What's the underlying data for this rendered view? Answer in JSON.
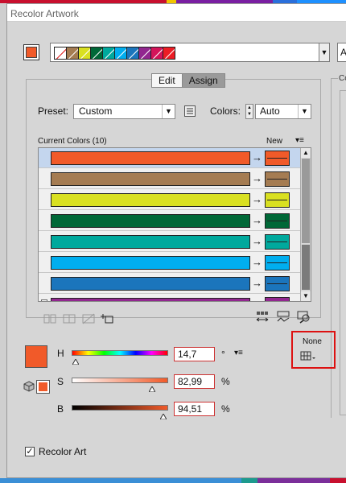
{
  "app_strip_colors": [
    "#c8102e",
    "#c8102e",
    "#f2c500",
    "#7a1fa2",
    "#2a6fdb",
    "#1e90ff"
  ],
  "bottom_strip_colors": [
    "#3b8fd6",
    "#1d9a8e",
    "#7b2f9a",
    "#c8102e"
  ],
  "title": "Recolor Artwork",
  "main_color": "#f15a29",
  "color_group_chips": [
    {
      "color": "#ffffff",
      "none": true
    },
    {
      "color": "#a57c52"
    },
    {
      "color": "#d9e021"
    },
    {
      "color": "#006837"
    },
    {
      "color": "#00a99d"
    },
    {
      "color": "#00aeef"
    },
    {
      "color": "#1b75bc"
    },
    {
      "color": "#92278f"
    },
    {
      "color": "#d4145a"
    },
    {
      "color": "#ed1c24"
    }
  ],
  "right_panel_label": "Colo",
  "right_edge_text": "A",
  "tabs": {
    "edit": "Edit",
    "assign": "Assign"
  },
  "preset": {
    "label": "Preset:",
    "value": "Custom"
  },
  "colors": {
    "label": "Colors:",
    "value": "Auto"
  },
  "list": {
    "current_label": "Current Colors (10)",
    "new_label": "New",
    "rows": [
      {
        "color": "#f15a29",
        "selected": true
      },
      {
        "color": "#a57c52"
      },
      {
        "color": "#d9e021"
      },
      {
        "color": "#006837"
      },
      {
        "color": "#00a99d"
      },
      {
        "color": "#00aeef"
      },
      {
        "color": "#1b75bc"
      },
      {
        "color": "#92278f"
      }
    ]
  },
  "hsb": {
    "h_label": "H",
    "h_value": "14,7",
    "h_unit": "°",
    "h_pos": 0.04,
    "s_label": "S",
    "s_value": "82,99",
    "s_unit": "%",
    "s_pos": 0.83,
    "b_label": "B",
    "b_value": "94,51",
    "b_unit": "%",
    "b_pos": 0.95
  },
  "none_label": "None",
  "recolor_art": {
    "label": "Recolor Art",
    "checked": true,
    "checkmark": "✓"
  }
}
